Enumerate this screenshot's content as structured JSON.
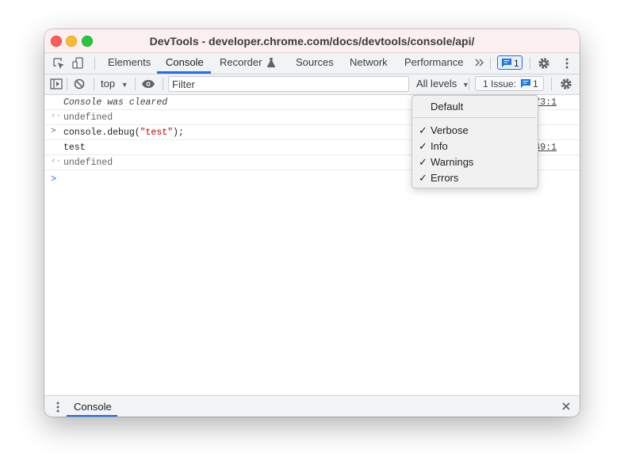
{
  "window": {
    "title": "DevTools - developer.chrome.com/docs/devtools/console/api/"
  },
  "main_tabs": [
    {
      "label": "Elements"
    },
    {
      "label": "Console",
      "active": true
    },
    {
      "label": "Recorder"
    },
    {
      "label": "Sources"
    },
    {
      "label": "Network"
    },
    {
      "label": "Performance"
    }
  ],
  "tabbar": {
    "more_icon": "double-chevron-right",
    "messages_count": "1",
    "settings_icon": "gear",
    "menu_icon": "kebab-vertical"
  },
  "toolbar": {
    "context": "top",
    "filter_placeholder": "Filter",
    "levels_label": "All levels",
    "issues_label": "1 Issue:",
    "issues_count": "1"
  },
  "console": {
    "rows": [
      {
        "text": "Console was cleared",
        "source": "73:1"
      },
      {
        "gutter": "‹·",
        "text": "undefined"
      },
      {
        "gutter": ">",
        "code_before": "console.debug(",
        "code_string": "\"test\"",
        "code_after": ");"
      },
      {
        "text": "test",
        "source": "49:1"
      },
      {
        "gutter": "‹·",
        "text": "undefined"
      }
    ],
    "prompt": ">"
  },
  "levels_menu": {
    "default_label": "Default",
    "items": [
      {
        "label": "Verbose",
        "checked": true,
        "check": "✓"
      },
      {
        "label": "Info",
        "checked": true,
        "check": "✓"
      },
      {
        "label": "Warnings",
        "checked": true,
        "check": "✓"
      },
      {
        "label": "Errors",
        "checked": true,
        "check": "✓"
      }
    ]
  },
  "drawer": {
    "tab_label": "Console",
    "close_icon": "close"
  },
  "colors": {
    "accent": "#1a73e8",
    "string": "#c80000",
    "close": "#ff5f57",
    "minimize": "#febc2e",
    "maximize": "#28c840"
  }
}
